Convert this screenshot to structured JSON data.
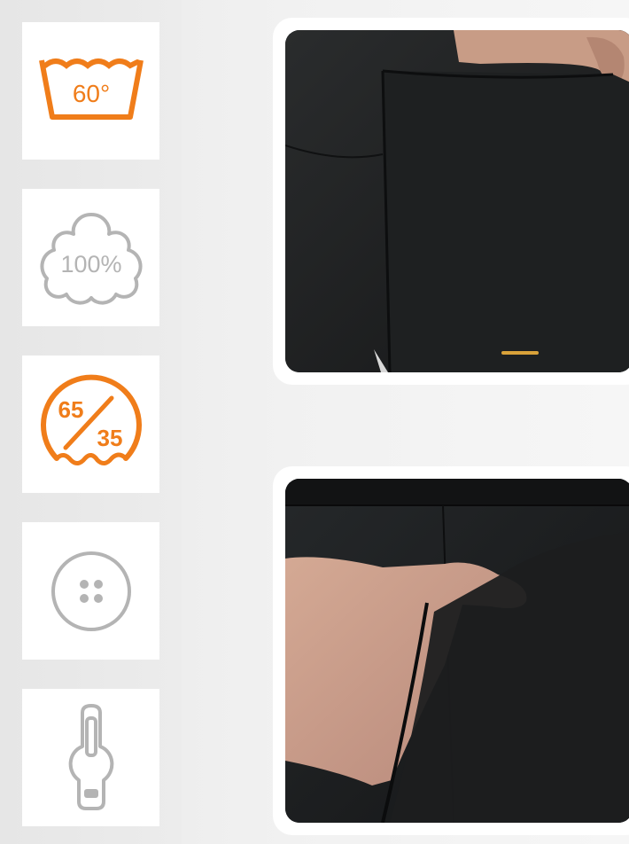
{
  "features": [
    {
      "icon": "wash-60-icon",
      "label": "60°",
      "color": "#f07d1a"
    },
    {
      "icon": "cotton-100-icon",
      "label": "100%",
      "color": "#b4b4b4"
    },
    {
      "icon": "blend-65-35-icon",
      "top": "65",
      "bottom": "35",
      "color": "#f07d1a"
    },
    {
      "icon": "button-icon",
      "color": "#b4b4b4"
    },
    {
      "icon": "zipper-icon",
      "color": "#b4b4b4"
    }
  ],
  "photos": [
    {
      "name": "shorts-pocket-closeup-photo",
      "logo_color": "#d9a23a"
    },
    {
      "name": "hand-in-pocket-photo"
    }
  ]
}
